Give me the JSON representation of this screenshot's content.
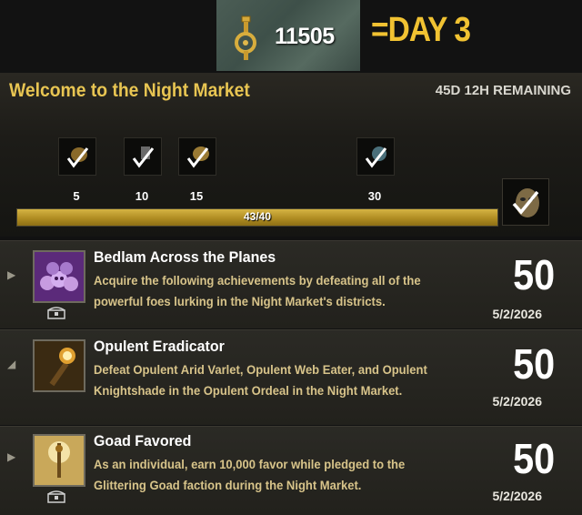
{
  "currency": {
    "value": "11505",
    "icon": "key-icon"
  },
  "day_label": "=DAY 3",
  "event": {
    "title": "Welcome to the Night Market",
    "time_remaining": "45D 12H REMAINING",
    "tiers": [
      {
        "label": "5",
        "icon": "reward-icon",
        "claimed": true
      },
      {
        "label": "10",
        "icon": "reward-icon",
        "claimed": true
      },
      {
        "label": "15",
        "icon": "reward-icon",
        "claimed": true
      },
      {
        "label": "30",
        "icon": "reward-icon",
        "claimed": true
      }
    ],
    "progress": {
      "text": "43/40",
      "fraction": 1.0
    },
    "final_reward_icon": "mask-icon"
  },
  "achievements": [
    {
      "title": "Bedlam Across the Planes",
      "description": "Acquire the following achievements by defeating all of the powerful foes lurking in the Night Market's districts.",
      "points": "50",
      "date": "5/2/2026",
      "icon": "skulls-icon",
      "arrow": "▶",
      "has_chest": true
    },
    {
      "title": "Opulent Eradicator",
      "description": "Defeat Opulent Arid Varlet, Opulent Web Eater, and Opulent Knightshade in the Opulent Ordeal in the Night Market.",
      "points": "50",
      "date": "5/2/2026",
      "icon": "torch-icon",
      "arrow": "◢",
      "has_chest": false
    },
    {
      "title": "Goad Favored",
      "description": "As an individual, earn 10,000 favor while pledged to the Glittering Goad faction during the Night Market.",
      "points": "50",
      "date": "5/2/2026",
      "icon": "goad-icon",
      "arrow": "▶",
      "has_chest": true
    }
  ],
  "colors": {
    "accent_gold": "#e8c552",
    "day_yellow": "#f1c232",
    "desc_tan": "#d8c48a",
    "progress_gold": "#b08d22"
  }
}
